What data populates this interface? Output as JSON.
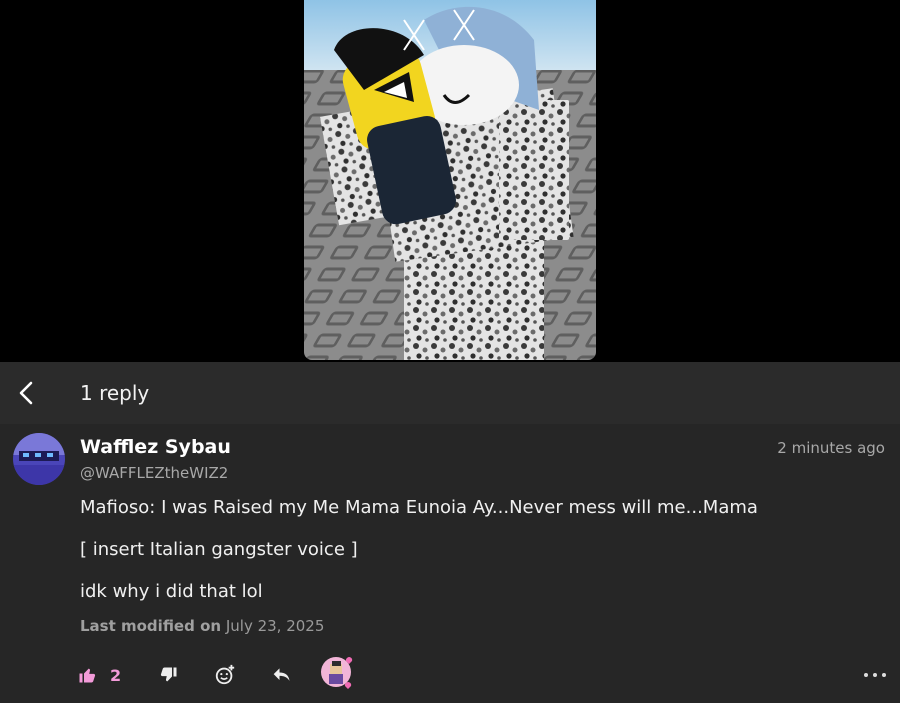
{
  "header": {
    "title": "1 reply"
  },
  "comment": {
    "display_name": "Wafflez Sybau",
    "handle": "@WAFFLEZtheWIZ2",
    "timestamp": "2 minutes ago",
    "lines": [
      "Mafioso: I was Raised my Me Mama Eunoia Ay...Never mess will me...Mama",
      "[ insert Italian gangster voice ]",
      "idk why i did that lol"
    ],
    "modified_label": "Last modified on",
    "modified_date": "July 23, 2025"
  },
  "actions": {
    "like_count": "2",
    "like_color": "#f39bd9"
  },
  "icons": [
    "back-icon",
    "thumbs-up-icon",
    "thumbs-down-icon",
    "add-reaction-icon",
    "reply-icon",
    "more-icon"
  ]
}
